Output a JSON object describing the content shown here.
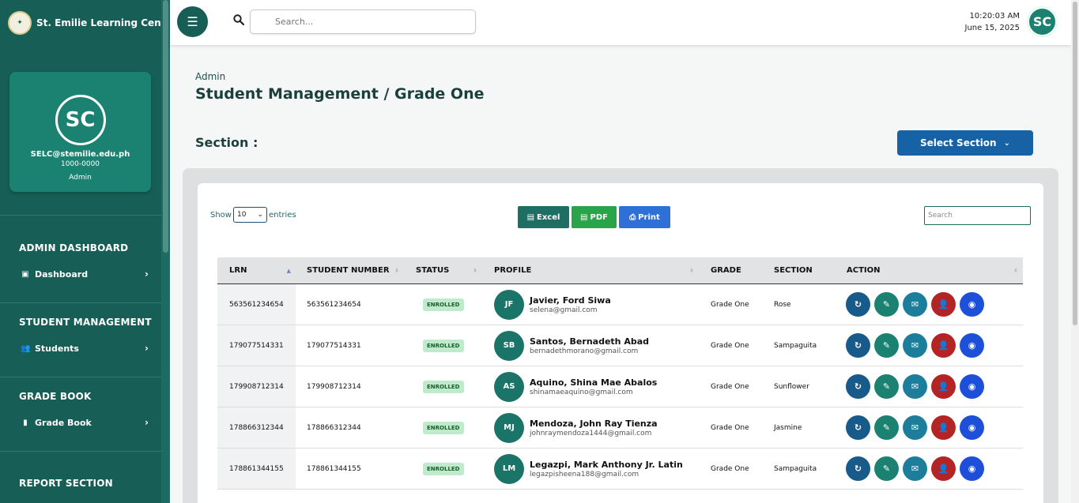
{
  "brand": {
    "name": "St. Emilie Learning Center",
    "logo_icon": "school-seal-icon"
  },
  "profile": {
    "initials": "SC",
    "email": "SELC@stemilie.edu.ph",
    "id": "1000-0000",
    "role": "Admin"
  },
  "nav": [
    {
      "heading": "ADMIN DASHBOARD",
      "item": "Dashboard",
      "icon": "dashboard-icon"
    },
    {
      "heading": "STUDENT MANAGEMENT",
      "item": "Students",
      "icon": "users-icon"
    },
    {
      "heading": "GRADE BOOK",
      "item": "Grade Book",
      "icon": "book-icon"
    },
    {
      "heading": "REPORT SECTION"
    }
  ],
  "topbar": {
    "search_placeholder": "Search...",
    "time": "10:20:03 AM",
    "date": "June 15, 2025",
    "avatar": "SC"
  },
  "breadcrumb": "Admin",
  "page_title": "Student Management / Grade One",
  "section_label": "Section :",
  "select_section": "Select Section",
  "table_controls": {
    "show": "Show",
    "entries_value": "10",
    "entries": "entries",
    "excel": "Excel",
    "pdf": "PDF",
    "print": "Print",
    "search_placeholder": "Search"
  },
  "columns": [
    "LRN",
    "STUDENT NUMBER",
    "STATUS",
    "PROFILE",
    "GRADE",
    "SECTION",
    "ACTION"
  ],
  "rows": [
    {
      "lrn": "563561234654",
      "number": "563561234654",
      "status": "ENROLLED",
      "initials": "JF",
      "name": "Javier, Ford Siwa",
      "email": "selena@gmail.com",
      "grade": "Grade One",
      "section": "Rose"
    },
    {
      "lrn": "179077514331",
      "number": "179077514331",
      "status": "ENROLLED",
      "initials": "SB",
      "name": "Santos, Bernadeth Abad",
      "email": "bernadethmorano@gmail.com",
      "grade": "Grade One",
      "section": "Sampaguita"
    },
    {
      "lrn": "179908712314",
      "number": "179908712314",
      "status": "ENROLLED",
      "initials": "AS",
      "name": "Aquino, Shina Mae Abalos",
      "email": "shinamaeaquino@gmail.com",
      "grade": "Grade One",
      "section": "Sunflower"
    },
    {
      "lrn": "178866312344",
      "number": "178866312344",
      "status": "ENROLLED",
      "initials": "MJ",
      "name": "Mendoza, John Ray Tienza",
      "email": "johnraymendoza1444@gmail.com",
      "grade": "Grade One",
      "section": "Jasmine"
    },
    {
      "lrn": "178861344155",
      "number": "178861344155",
      "status": "ENROLLED",
      "initials": "LM",
      "name": "Legazpi, Mark Anthony Jr. Latin",
      "email": "legazpisheena188@gmail.com",
      "grade": "Grade One",
      "section": "Sampaguita"
    }
  ],
  "action_icons": [
    "refresh-icon",
    "edit-icon",
    "mail-icon",
    "remove-user-icon",
    "view-icon"
  ],
  "colors": {
    "sidebar": "#165e56",
    "accent": "#1b8272",
    "primary_button": "#1662a4",
    "badge_bg": "#bfeacc",
    "delete": "#b52424"
  }
}
